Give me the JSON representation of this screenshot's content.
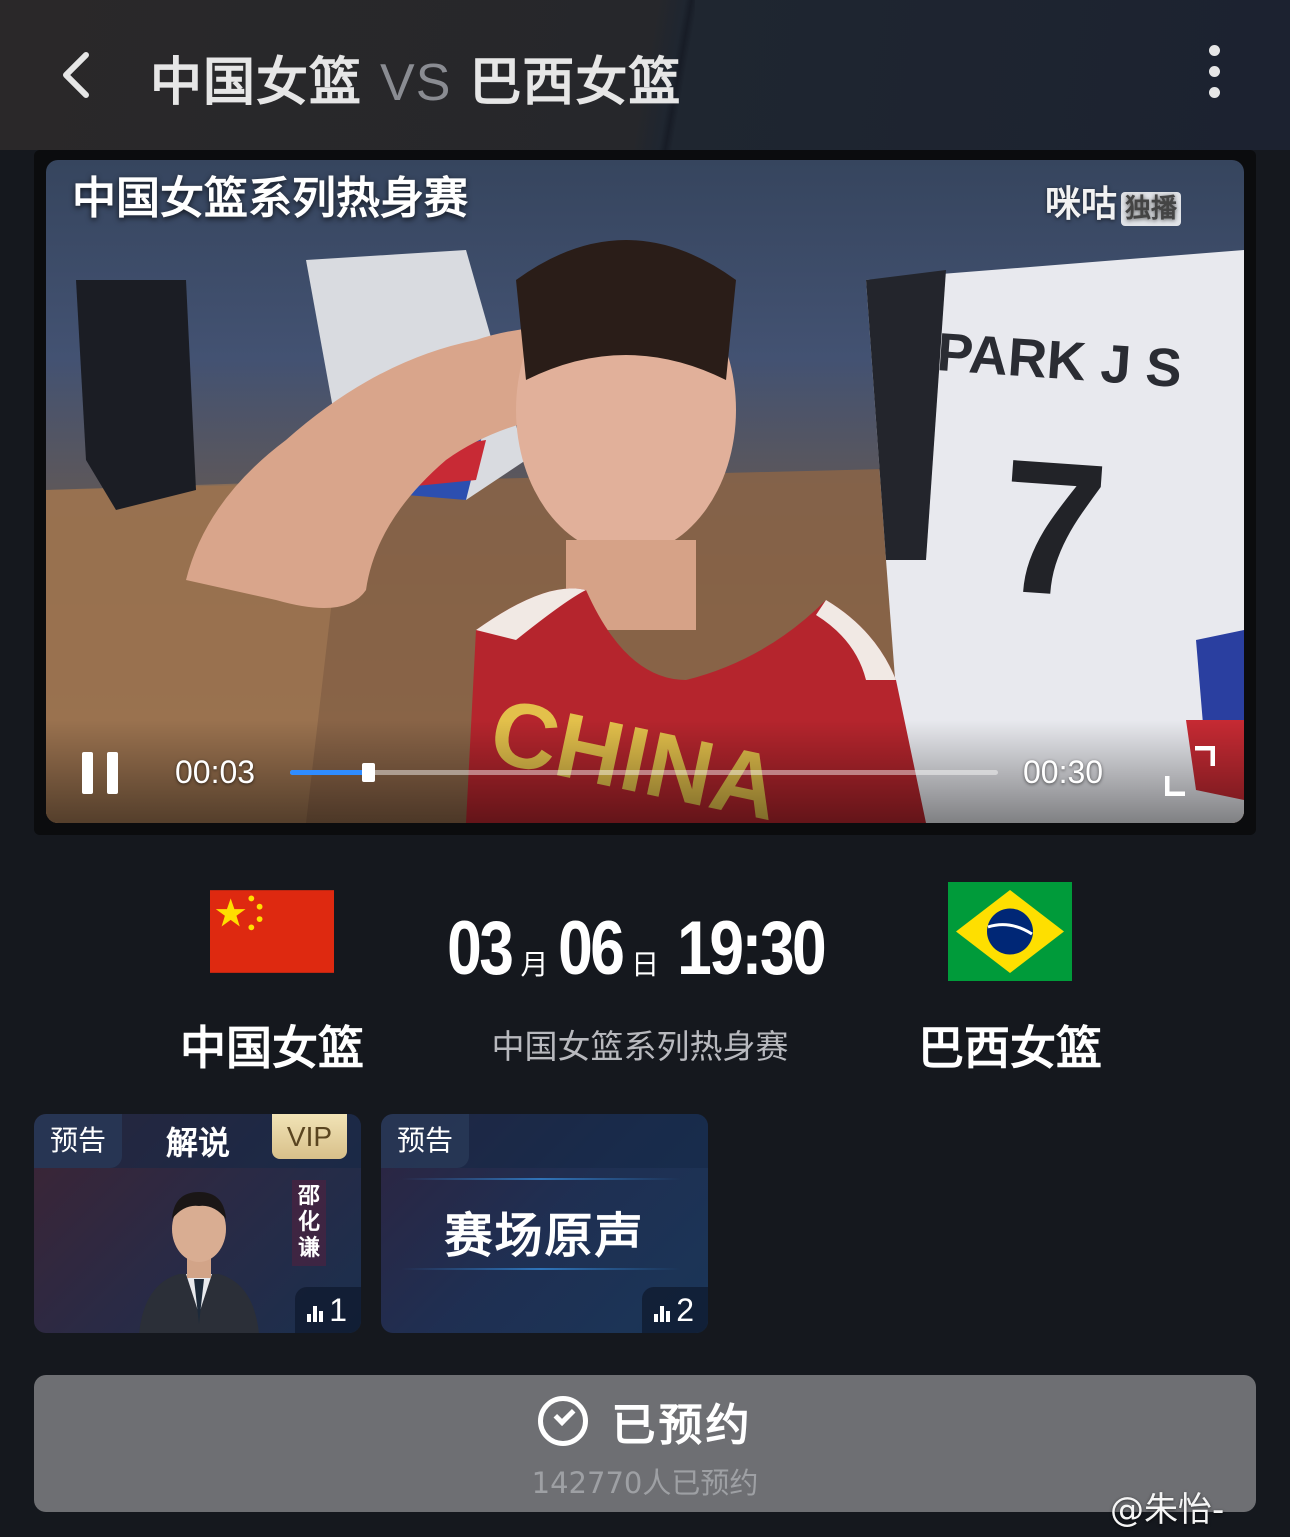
{
  "header": {
    "team_home": "中国女篮",
    "vs": "VS",
    "team_away": "巴西女篮"
  },
  "video": {
    "overlay_title": "中国女篮系列热身赛",
    "watermark": "咪咕",
    "watermark_tag": "独播",
    "current_time": "00:03",
    "total_time": "00:30",
    "progress": 0.11,
    "jersey_name": "PARK J S",
    "jersey_number": "7",
    "jersey_text": "CHINA"
  },
  "match": {
    "home_name": "中国女篮",
    "away_name": "巴西女篮",
    "month": "03",
    "month_unit": "月",
    "day": "06",
    "day_unit": "日",
    "time": "19:30",
    "event": "中国女篮系列热身赛"
  },
  "cards": [
    {
      "badge": "预告",
      "label": "解说",
      "vip": "VIP",
      "commentator": "邵化谦",
      "count": "1"
    },
    {
      "badge": "预告",
      "label": "赛场原声",
      "count": "2"
    }
  ],
  "reserve": {
    "label": "已预约",
    "count_text": "142770人已预约"
  },
  "weibo_mark": "@朱怡-",
  "icons": [
    "back-icon",
    "more-icon",
    "pause-icon",
    "fullscreen-icon",
    "check-circle-icon",
    "bar-chart-icon"
  ],
  "colors": {
    "progress": "#2f8cff",
    "vip": "#e7d29e",
    "background": "#15181e"
  }
}
